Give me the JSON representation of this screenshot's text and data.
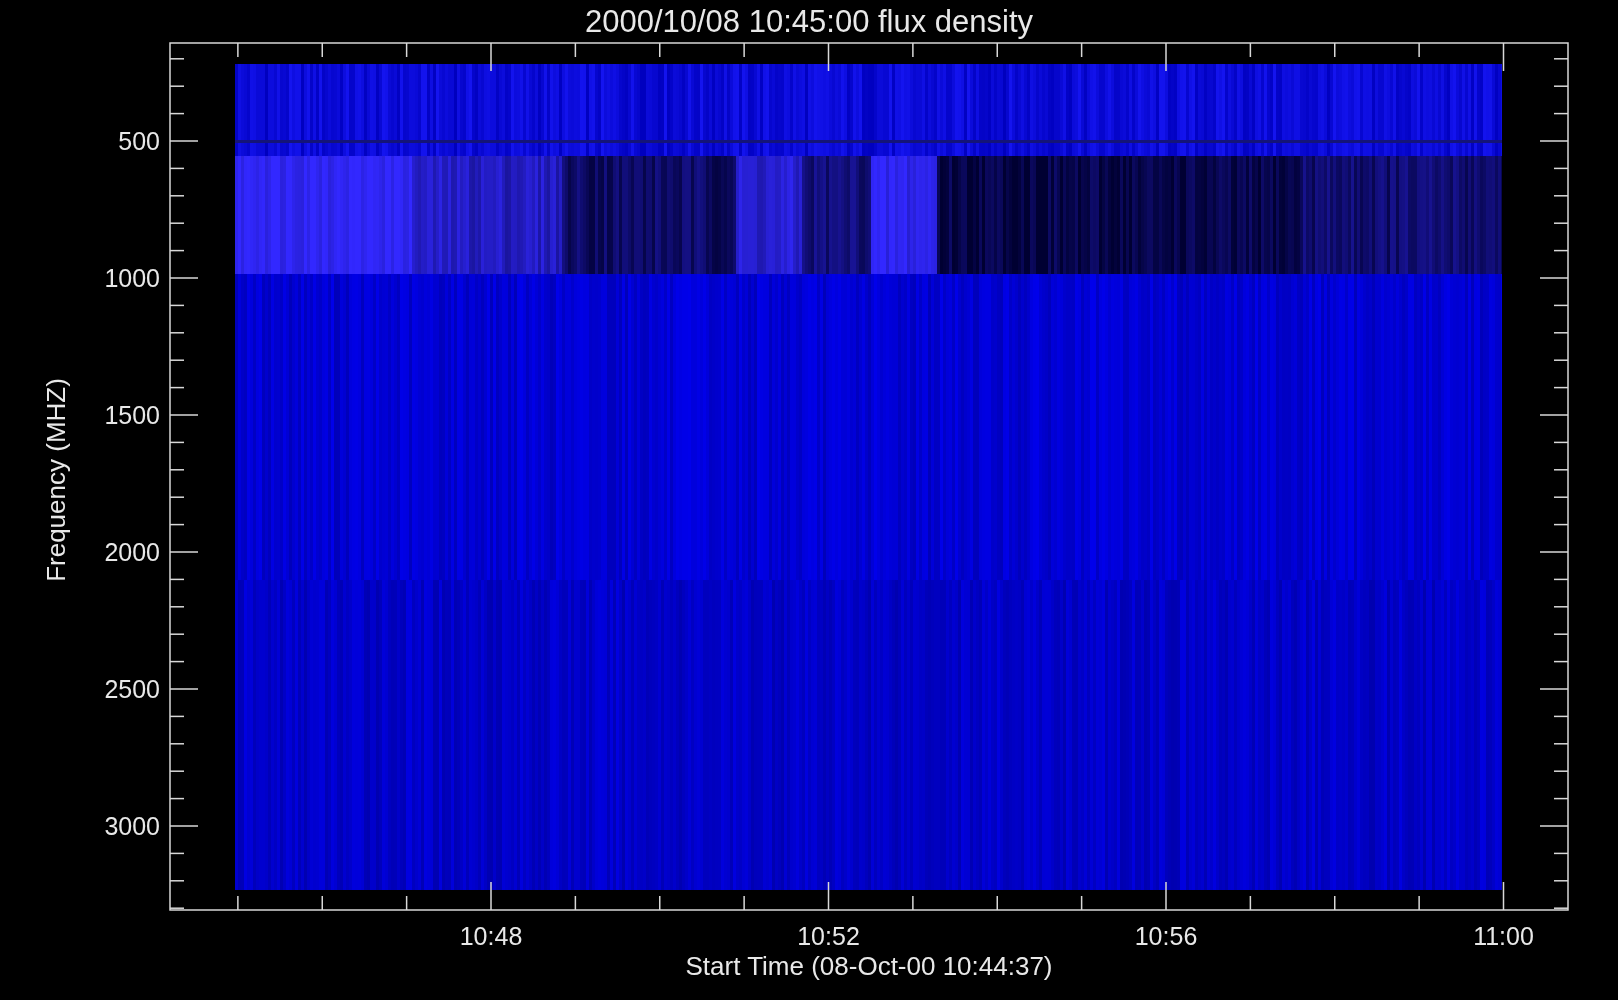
{
  "title": "2000/10/08 10:45:00 flux density",
  "ylabel": "Frequency (MHZ)",
  "xlabel": "Start Time (08-Oct-00 10:44:37)",
  "yticks": [
    "500",
    "1000",
    "1500",
    "2000",
    "2500",
    "3000"
  ],
  "xticks": [
    "10:48",
    "10:52",
    "10:56",
    "11:00"
  ]
}
